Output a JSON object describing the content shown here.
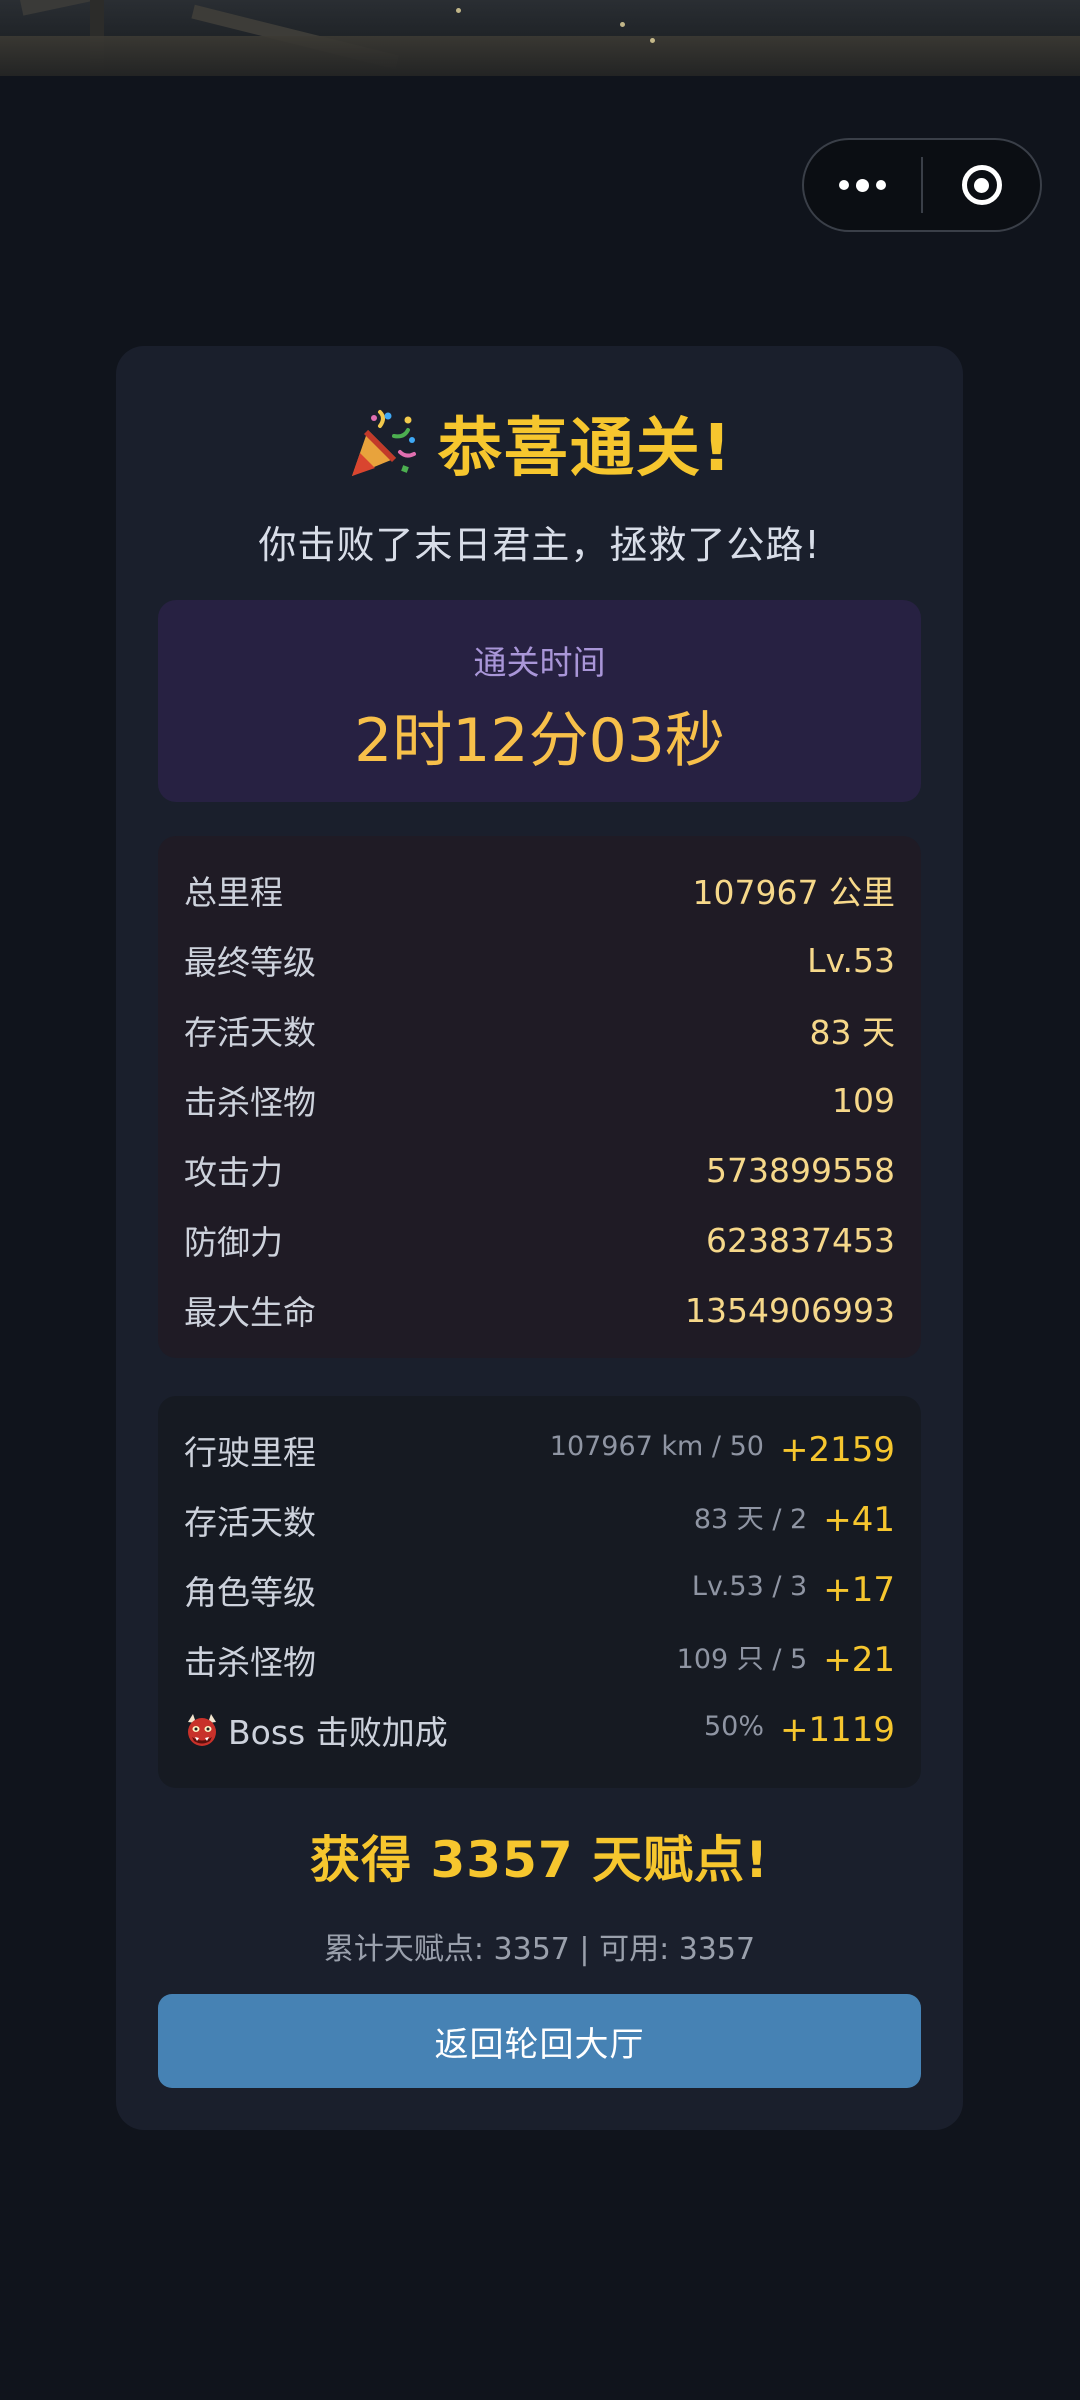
{
  "capsule": {
    "more_icon": "more-dots-icon",
    "close_icon": "target-circle-icon"
  },
  "result": {
    "title_icon": "party-popper-icon",
    "title": "恭喜通关!",
    "subtitle": "你击败了末日君主，拯救了公路!"
  },
  "clear_time": {
    "label": "通关时间",
    "value": "2时12分03秒"
  },
  "stats": [
    {
      "label": "总里程",
      "value": "107967 公里"
    },
    {
      "label": "最终等级",
      "value": "Lv.53"
    },
    {
      "label": "存活天数",
      "value": "83 天"
    },
    {
      "label": "击杀怪物",
      "value": "109"
    },
    {
      "label": "攻击力",
      "value": "573899558"
    },
    {
      "label": "防御力",
      "value": "623837453"
    },
    {
      "label": "最大生命",
      "value": "1354906993"
    }
  ],
  "bonuses": [
    {
      "label": "行驶里程",
      "formula": "107967 km / 50",
      "points": "+2159"
    },
    {
      "label": "存活天数",
      "formula": "83 天 / 2",
      "points": "+41"
    },
    {
      "label": "角色等级",
      "formula": "Lv.53 / 3",
      "points": "+17"
    },
    {
      "label": "击杀怪物",
      "formula": "109 只 / 5",
      "points": "+21"
    },
    {
      "label": "Boss 击败加成",
      "icon": "ogre-icon",
      "formula": "50%",
      "points": "+1119"
    }
  ],
  "earned": "获得 3357 天赋点!",
  "total": "累计天赋点: 3357 | 可用: 3357",
  "return_button": "返回轮回大厅",
  "colors": {
    "background": "#10141c",
    "card": "#1a1f2c",
    "gold": "#f6c62e",
    "time_box": "#272142",
    "button": "#4682b4"
  }
}
